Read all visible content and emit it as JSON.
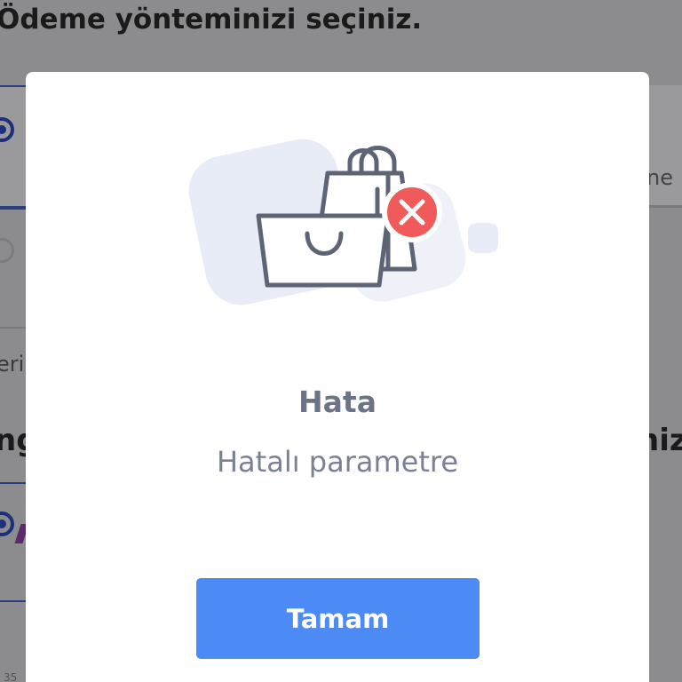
{
  "background": {
    "heading": "Ödeme yönteminizi seçiniz.",
    "fragments": {
      "right_option_text": "ne",
      "left_text": "eri",
      "left_heading_frag": "ng",
      "right_heading_frag": "niz",
      "bottom_left_small": "35"
    }
  },
  "dialog": {
    "illustration_icon": "shopping-bags-error-icon",
    "title": "Hata",
    "message": "Hatalı parametre",
    "ok_label": "Tamam"
  },
  "colors": {
    "overlay_bg": "#8c8c8e",
    "modal_bg": "#ffffff",
    "primary_button": "#4c8bf5",
    "error_badge": "#f05a5a",
    "title_text": "#6b7386",
    "illustration_stroke": "#5d6475",
    "illustration_blob": "#e8ecf6"
  }
}
